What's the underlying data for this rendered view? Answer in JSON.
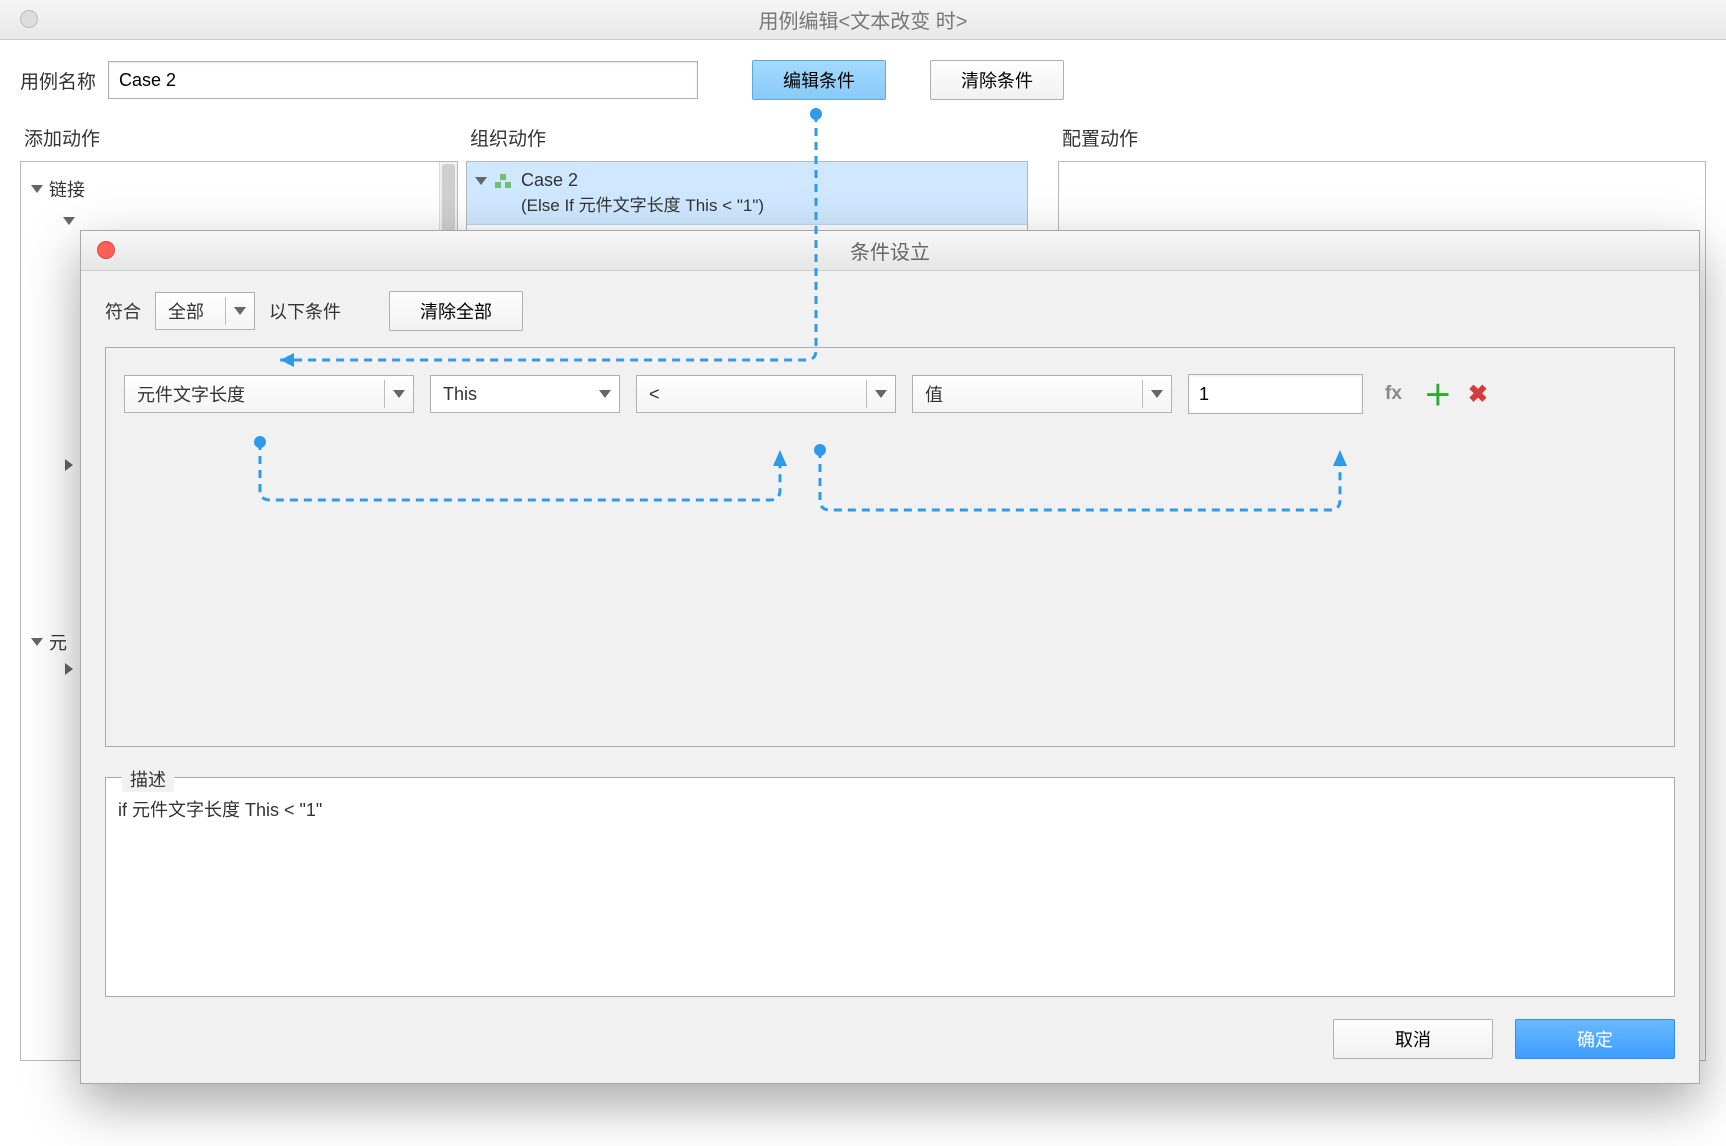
{
  "main": {
    "title": "用例编辑<文本改变 时>",
    "caseNameLabel": "用例名称",
    "caseNameValue": "Case 2",
    "editConditionBtn": "编辑条件",
    "clearConditionBtn": "清除条件",
    "addActionTitle": "添加动作",
    "orgActionTitle": "组织动作",
    "cfgActionTitle": "配置动作",
    "tree": {
      "links": "链接",
      "widgets": "元"
    },
    "caseNode": {
      "name": "Case 2",
      "sub": "(Else If 元件文字长度 This < \"1\")"
    }
  },
  "cond": {
    "title": "条件设立",
    "matchLabel": "符合",
    "matchValue": "全部",
    "followingLabel": "以下条件",
    "clearAllBtn": "清除全部",
    "row": {
      "type": "元件文字长度",
      "target": "This",
      "operator": "<",
      "rhsType": "值",
      "rhsValue": "1",
      "fx": "fx"
    },
    "descLegend": "描述",
    "descText": "if 元件文字长度 This < \"1\"",
    "cancel": "取消",
    "ok": "确定"
  }
}
